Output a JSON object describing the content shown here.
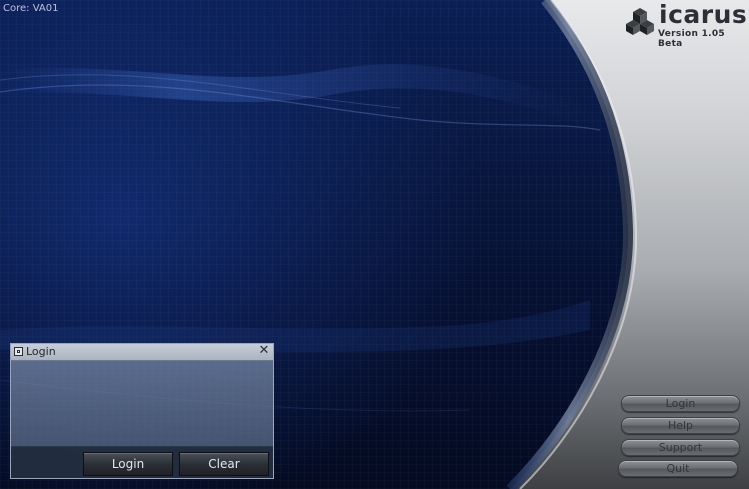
{
  "status": {
    "core_label": "Core: VA01"
  },
  "brand": {
    "name": "icarus",
    "version": "Version 1.05 Beta",
    "logo_icon": "cube-cluster-icon"
  },
  "nav": {
    "items": [
      {
        "label": "Login"
      },
      {
        "label": "Help"
      },
      {
        "label": "Support"
      },
      {
        "label": "Quit"
      }
    ]
  },
  "login_window": {
    "title": "Login",
    "close_glyph": "✕",
    "buttons": {
      "login_label": "Login",
      "clear_label": "Clear"
    }
  },
  "colors": {
    "background": "#08173f",
    "panel_gray": "#c9cbcf",
    "button_gray": "#6d7075"
  }
}
